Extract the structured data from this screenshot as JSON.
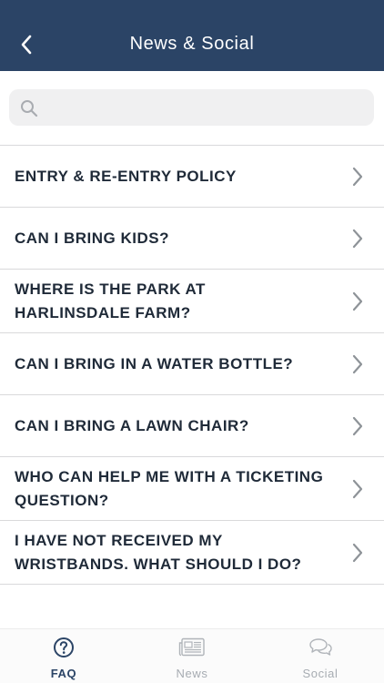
{
  "header": {
    "title": "News & Social",
    "back_icon": "chevron-left-icon"
  },
  "search": {
    "placeholder": "",
    "value": "",
    "icon": "search-icon"
  },
  "faq": {
    "items": [
      {
        "label": "ENTRY & RE-ENTRY POLICY"
      },
      {
        "label": "CAN I BRING KIDS?"
      },
      {
        "label": "WHERE IS THE PARK AT HARLINSDALE FARM?"
      },
      {
        "label": "CAN I BRING IN A WATER BOTTLE?"
      },
      {
        "label": "CAN I BRING A LAWN CHAIR?"
      },
      {
        "label": "WHO CAN HELP ME WITH A TICKETING QUESTION?"
      },
      {
        "label": "I HAVE NOT RECEIVED MY WRISTBANDS. WHAT SHOULD I DO?"
      }
    ]
  },
  "tabbar": {
    "tabs": [
      {
        "label": "FAQ",
        "icon": "question-circle-icon",
        "active": true
      },
      {
        "label": "News",
        "icon": "newspaper-icon",
        "active": false
      },
      {
        "label": "Social",
        "icon": "chat-bubbles-icon",
        "active": false
      }
    ]
  },
  "colors": {
    "header_bg": "#2b4466",
    "active_tab": "#2b4466",
    "inactive_tab": "#a7acb2",
    "text": "#1f2a38",
    "divider": "#d9d9db"
  }
}
